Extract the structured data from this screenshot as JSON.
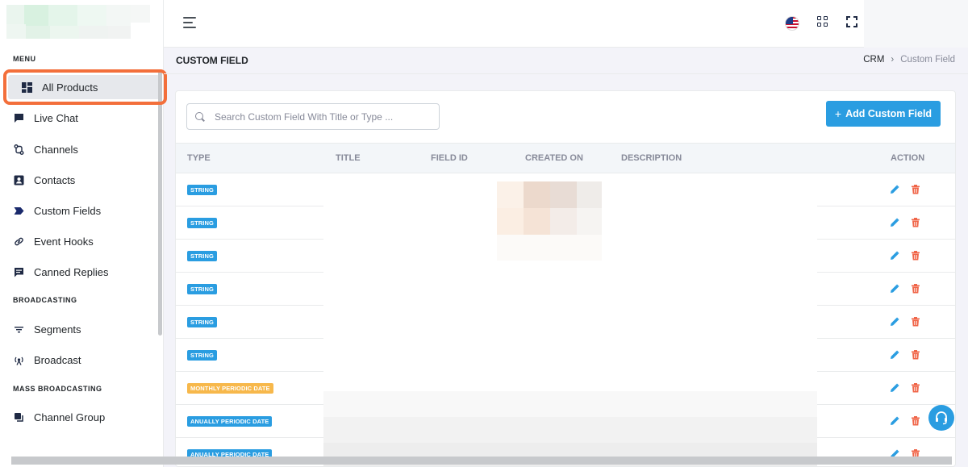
{
  "sidebar": {
    "menu_title": "MENU",
    "items": [
      {
        "label": "All Products",
        "icon": "dashboard-icon"
      },
      {
        "label": "Live Chat",
        "icon": "chat-icon"
      },
      {
        "label": "Channels",
        "icon": "channels-icon"
      },
      {
        "label": "Contacts",
        "icon": "contacts-icon"
      },
      {
        "label": "Custom Fields",
        "icon": "tag-icon"
      },
      {
        "label": "Event Hooks",
        "icon": "link-icon"
      },
      {
        "label": "Canned Replies",
        "icon": "message-icon"
      }
    ],
    "broadcasting_title": "BROADCASTING",
    "broadcasting_items": [
      {
        "label": "Segments",
        "icon": "filter-icon"
      },
      {
        "label": "Broadcast",
        "icon": "broadcast-icon"
      }
    ],
    "mass_title": "MASS BROADCASTING",
    "mass_items": [
      {
        "label": "Channel Group",
        "icon": "channel-group-icon"
      }
    ]
  },
  "page": {
    "title": "CUSTOM FIELD",
    "breadcrumb": [
      "CRM",
      "Custom Field"
    ]
  },
  "search": {
    "placeholder": "Search Custom Field With Title or Type ..."
  },
  "add_button": {
    "label": "Add Custom Field"
  },
  "table": {
    "headers": [
      "TYPE",
      "TITLE",
      "FIELD ID",
      "CREATED ON",
      "DESCRIPTION",
      "ACTION"
    ],
    "rows": [
      {
        "type": "STRING",
        "color": "blue"
      },
      {
        "type": "STRING",
        "color": "blue"
      },
      {
        "type": "STRING",
        "color": "blue"
      },
      {
        "type": "STRING",
        "color": "blue"
      },
      {
        "type": "STRING",
        "color": "blue"
      },
      {
        "type": "STRING",
        "color": "blue"
      },
      {
        "type": "MONTHLY PERIODIC DATE",
        "color": "yellow"
      },
      {
        "type": "ANUALLY PERIODIC DATE",
        "color": "blue"
      },
      {
        "type": "ANUALLY PERIODIC DATE",
        "color": "blue"
      }
    ]
  },
  "colors": {
    "accent": "#2a9de1",
    "warning": "#f7b84b",
    "danger": "#f06548",
    "highlight": "#f36f3b"
  }
}
